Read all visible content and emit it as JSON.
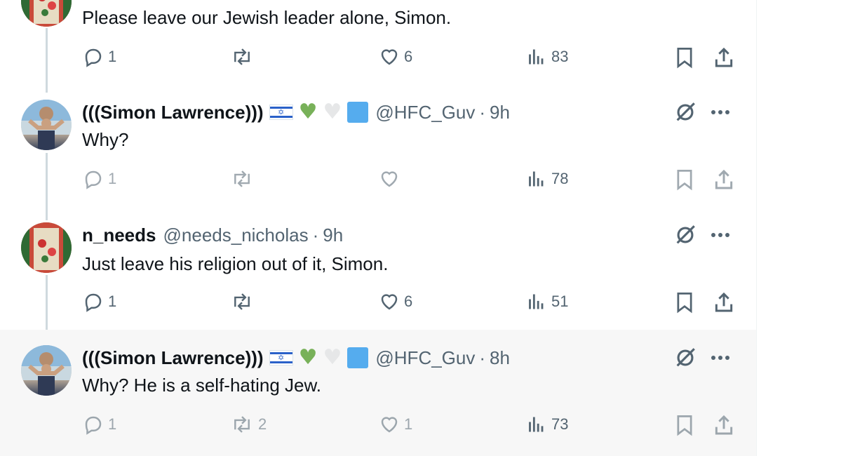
{
  "tweets": [
    {
      "text": "Please leave our Jewish leader alone, Simon.",
      "stats": {
        "replies": "1",
        "reposts": "",
        "likes": "6",
        "views": "83"
      }
    },
    {
      "name": "(((Simon Lawrence)))",
      "handle": "@HFC_Guv",
      "dot": "·",
      "time": "9h",
      "text": "Why?",
      "stats": {
        "replies": "1",
        "reposts": "",
        "likes": "",
        "views": "78"
      }
    },
    {
      "name": "n_needs",
      "handle": "@needs_nicholas",
      "dot": "·",
      "time": "9h",
      "text": "Just leave his religion out of it, Simon.",
      "stats": {
        "replies": "1",
        "reposts": "",
        "likes": "6",
        "views": "51"
      }
    },
    {
      "name": "(((Simon Lawrence)))",
      "handle": "@HFC_Guv",
      "dot": "·",
      "time": "8h",
      "text": "Why? He is a self-hating Jew.",
      "stats": {
        "replies": "1",
        "reposts": "2",
        "likes": "1",
        "views": "73"
      }
    }
  ],
  "emoji": {
    "flag": "✡",
    "green_heart": "♥",
    "white_heart": "♥"
  },
  "icons": {
    "reply": "reply-icon",
    "repost": "repost-icon",
    "like": "heart-icon",
    "views": "views-icon",
    "bookmark": "bookmark-icon",
    "share": "share-icon",
    "grok": "grok-icon",
    "more": "more-icon"
  },
  "colors": {
    "text": "#0f1419",
    "muted": "#536471",
    "thread_line": "#cfd9de",
    "highlight_bg": "#f7f7f7"
  }
}
